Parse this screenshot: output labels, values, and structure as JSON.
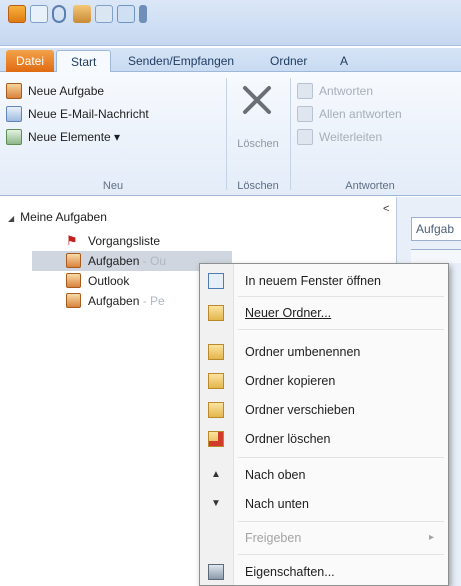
{
  "tabs": [
    "Datei",
    "Start",
    "Senden/Empfangen",
    "Ordner",
    "A"
  ],
  "ribbon": {
    "new_group": {
      "buttons": [
        "Neue Aufgabe",
        "Neue E-Mail-Nachricht",
        "Neue Elemente ▾"
      ],
      "label": "Neu"
    },
    "delete_group": {
      "button": "Löschen",
      "label": "Löschen"
    },
    "reply_group": {
      "buttons": [
        "Antworten",
        "Allen antworten",
        "Weiterleiten"
      ],
      "label": "Antworten"
    }
  },
  "nav": {
    "header": "Meine Aufgaben",
    "collapse_glyph": "<",
    "items": [
      {
        "label": "Vorgangsliste",
        "suffix": ""
      },
      {
        "label": "Aufgaben",
        "suffix": " - Ou"
      },
      {
        "label": "Outlook",
        "suffix": ""
      },
      {
        "label": "Aufgaben",
        "suffix": " - Pe"
      }
    ]
  },
  "search": {
    "value": "Aufgab"
  },
  "context_menu": {
    "items": [
      {
        "label": "In neuem Fenster öffnen",
        "enabled": true,
        "icon": "new-window-icon"
      },
      {
        "label": "Neuer Ordner...",
        "enabled": true,
        "icon": "new-folder-icon"
      },
      {
        "label": "Ordner umbenennen",
        "enabled": true,
        "icon": "rename-folder-icon"
      },
      {
        "label": "Ordner kopieren",
        "enabled": true,
        "icon": "copy-folder-icon"
      },
      {
        "label": "Ordner verschieben",
        "enabled": true,
        "icon": "move-folder-icon"
      },
      {
        "label": "Ordner löschen",
        "enabled": true,
        "icon": "delete-folder-icon"
      },
      {
        "label": "Nach oben",
        "enabled": true,
        "icon": "arrow-up-icon"
      },
      {
        "label": "Nach unten",
        "enabled": true,
        "icon": "arrow-down-icon"
      },
      {
        "label": "Freigeben",
        "enabled": false,
        "icon": "",
        "submenu": "▸"
      },
      {
        "label": "Eigenschaften...",
        "enabled": true,
        "icon": "properties-icon"
      }
    ]
  },
  "colors": {
    "file_tab": "#e06a12",
    "selection": "#cfd6df",
    "menu_border": "#8e8f8f"
  }
}
